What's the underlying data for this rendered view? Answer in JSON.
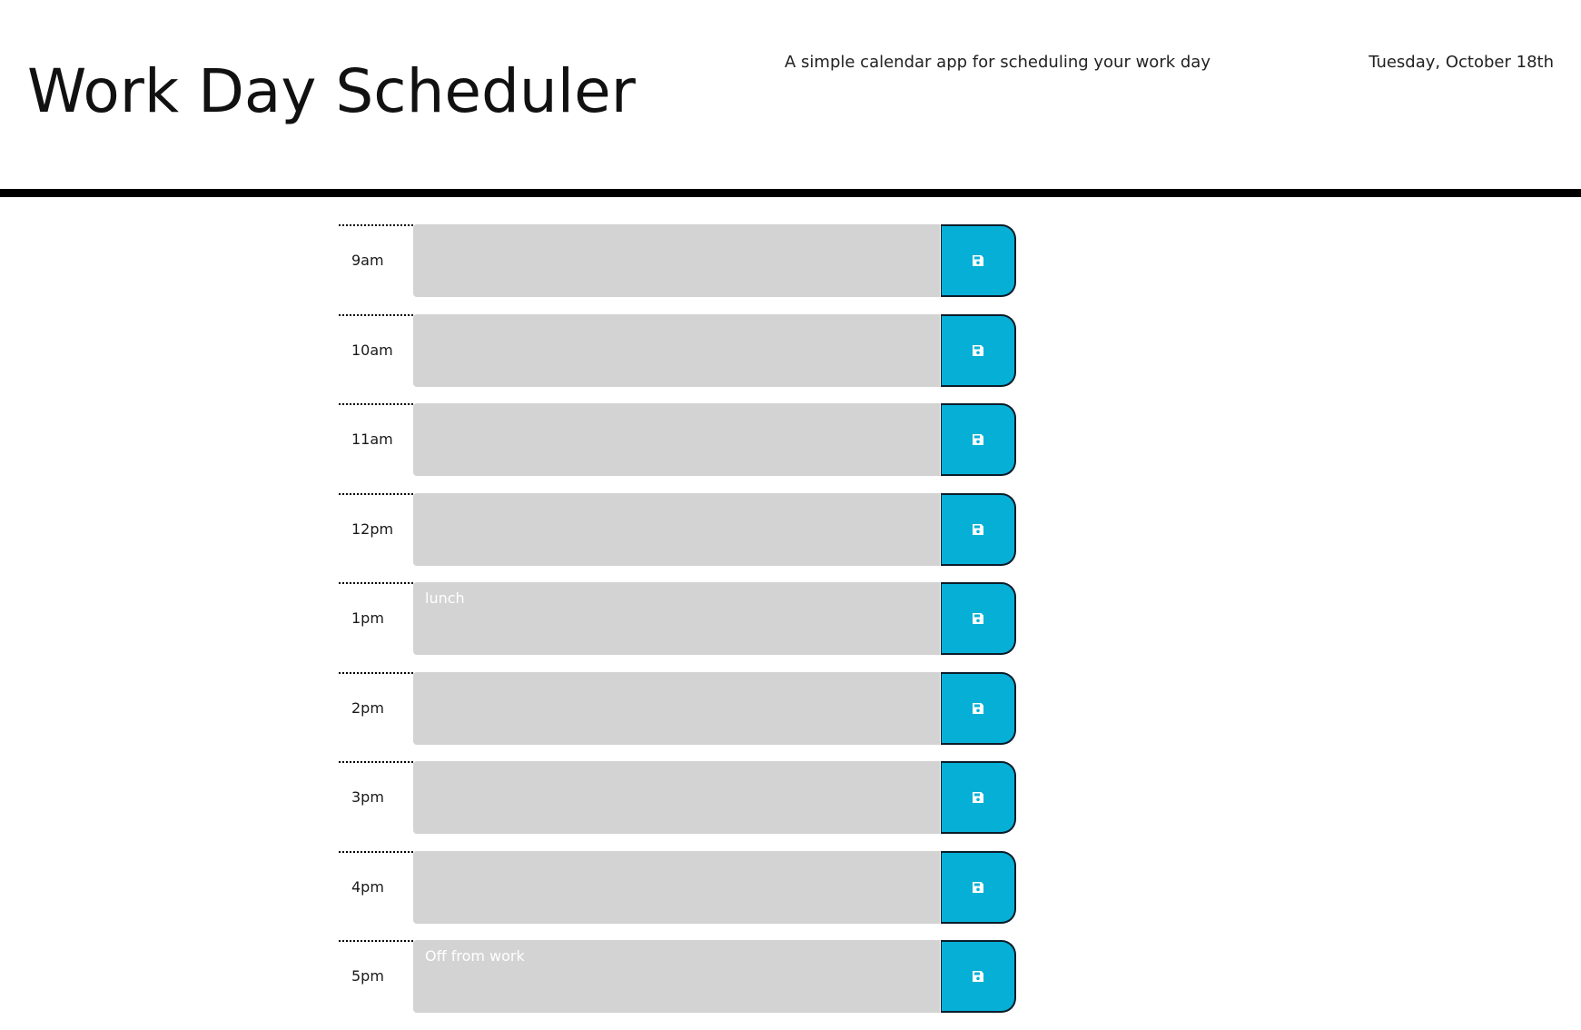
{
  "header": {
    "title": "Work Day Scheduler",
    "subtitle": "A simple calendar app for scheduling your work day",
    "date": "Tuesday, October 18th"
  },
  "colors": {
    "divider": "#000000",
    "time_block": "#d3d3d3",
    "save_button": "#06afd6",
    "save_icon": "#ffffff"
  },
  "rows": [
    {
      "hour": "9am",
      "text": "",
      "save_icon": "save-icon"
    },
    {
      "hour": "10am",
      "text": "",
      "save_icon": "save-icon"
    },
    {
      "hour": "11am",
      "text": "",
      "save_icon": "save-icon"
    },
    {
      "hour": "12pm",
      "text": "",
      "save_icon": "save-icon"
    },
    {
      "hour": "1pm",
      "text": "lunch",
      "save_icon": "save-icon"
    },
    {
      "hour": "2pm",
      "text": "",
      "save_icon": "save-icon"
    },
    {
      "hour": "3pm",
      "text": "",
      "save_icon": "save-icon"
    },
    {
      "hour": "4pm",
      "text": "",
      "save_icon": "save-icon"
    },
    {
      "hour": "5pm",
      "text": "Off from work",
      "save_icon": "save-icon"
    }
  ]
}
